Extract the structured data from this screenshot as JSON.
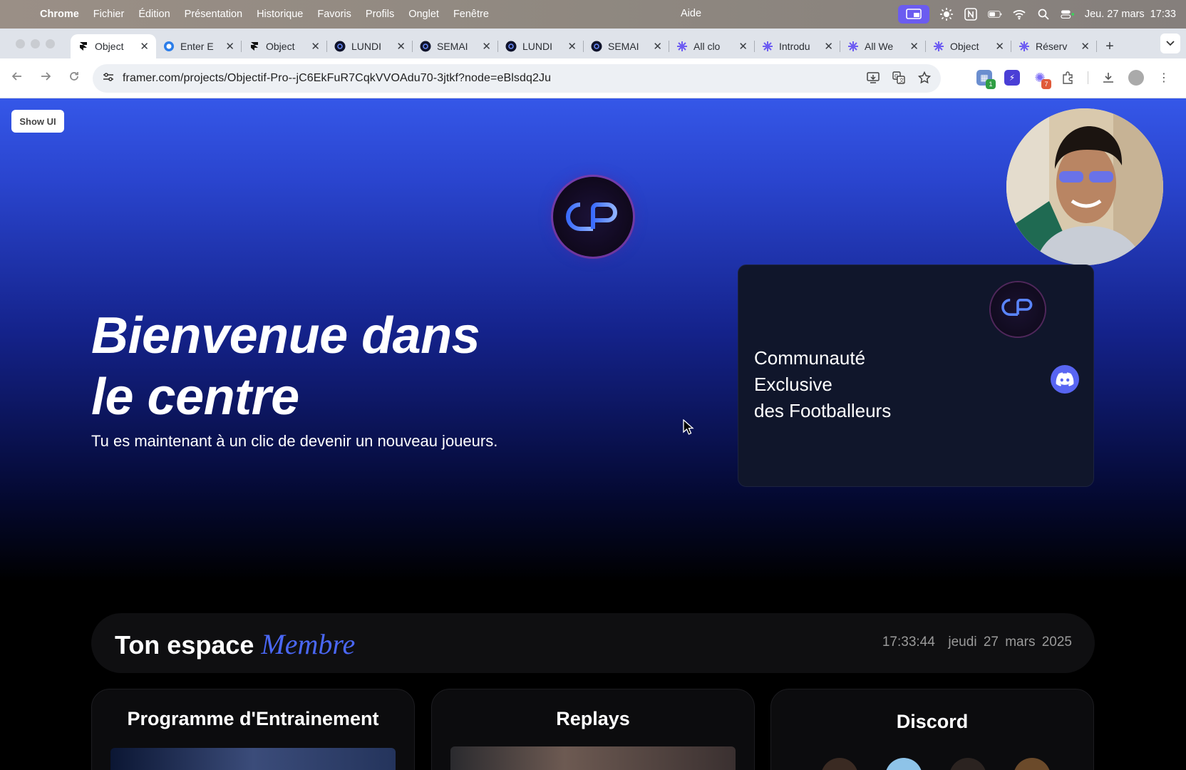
{
  "menubar": {
    "app": "Chrome",
    "items": [
      "Fichier",
      "Édition",
      "Présentation",
      "Historique",
      "Favoris",
      "Profils",
      "Onglet",
      "Fenêtre"
    ],
    "help": "Aide",
    "datetime": "Jeu. 27 mars  17:33"
  },
  "tabs": [
    {
      "label": "Object",
      "icon": "framer-icon",
      "active": true
    },
    {
      "label": "Enter E",
      "icon": "globe-icon"
    },
    {
      "label": "Object",
      "icon": "framer-icon"
    },
    {
      "label": "LUNDI",
      "icon": "op-logo-icon"
    },
    {
      "label": "SEMAI",
      "icon": "op-logo-icon"
    },
    {
      "label": "LUNDI",
      "icon": "op-logo-icon"
    },
    {
      "label": "SEMAI",
      "icon": "op-logo-icon"
    },
    {
      "label": "All clo",
      "icon": "gear-purple-icon"
    },
    {
      "label": "Introdu",
      "icon": "gear-purple-icon"
    },
    {
      "label": "All We",
      "icon": "gear-purple-icon"
    },
    {
      "label": "Object",
      "icon": "gear-purple-icon"
    },
    {
      "label": "Réserv",
      "icon": "gear-purple-icon"
    }
  ],
  "address": {
    "url": "framer.com/projects/Objectif-Pro--jC6EkFuR7CqkVVOAdu70-3jtkf?node=eBlsdq2Ju"
  },
  "extensions": {
    "badge1": "1",
    "badge2": "7"
  },
  "page": {
    "show_ui": "Show UI",
    "hero_title_line1": "Bienvenue dans",
    "hero_title_line2": "le centre",
    "hero_subtitle": "Tu es maintenant à un clic de devenir un nouveau joueurs.",
    "card_title": "Communauté\nExclusive\ndes Footballeurs",
    "member_title": "Ton espace ",
    "member_accent": "Membre",
    "clock_time": "17:33:44",
    "clock_date": "jeudi 27 mars 2025",
    "tiles": [
      "Programme d'Entrainement",
      "Replays",
      "Discord"
    ]
  },
  "colors": {
    "accent": "#4a67f5",
    "discord": "#5865f2",
    "screenrec": "#6b5cf0"
  }
}
